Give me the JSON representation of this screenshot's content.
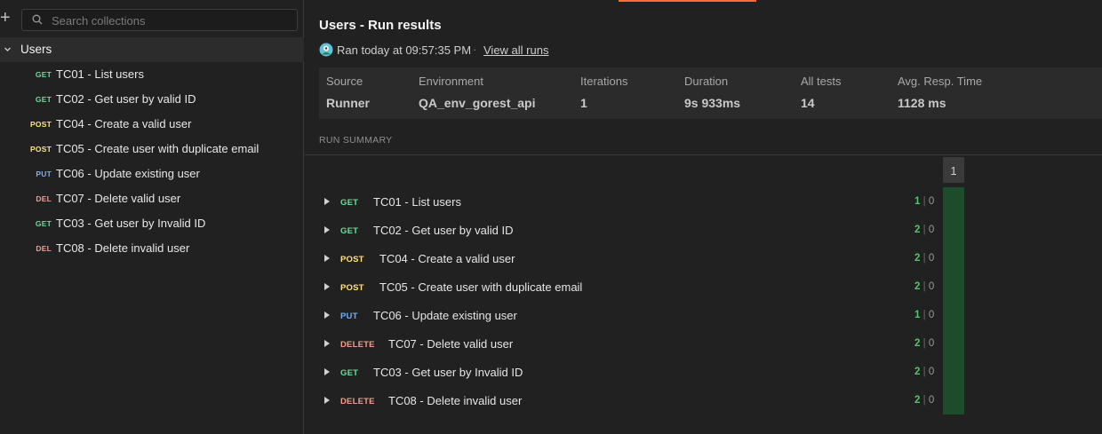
{
  "sidebar": {
    "search_placeholder": "Search collections",
    "collection": {
      "name": "Users"
    },
    "items": [
      {
        "method": "GET",
        "label": "TC01 - List users"
      },
      {
        "method": "GET",
        "label": "TC02 - Get user by valid ID"
      },
      {
        "method": "POST",
        "label": "TC04 - Create a valid user"
      },
      {
        "method": "POST",
        "label": "TC05 - Create user with duplicate email"
      },
      {
        "method": "PUT",
        "label": "TC06 - Update existing user"
      },
      {
        "method": "DEL",
        "label": "TC07 - Delete valid user"
      },
      {
        "method": "GET",
        "label": "TC03 - Get user by Invalid ID"
      },
      {
        "method": "DEL",
        "label": "TC08 - Delete invalid user"
      }
    ]
  },
  "main": {
    "title": "Users - Run results",
    "ran_text": "Ran today at 09:57:35 PM",
    "separator": "·",
    "view_all_runs": "View all runs",
    "stats": [
      {
        "label": "Source",
        "value": "Runner"
      },
      {
        "label": "Environment",
        "value": "QA_env_gorest_api"
      },
      {
        "label": "Iterations",
        "value": "1"
      },
      {
        "label": "Duration",
        "value": "9s 933ms"
      },
      {
        "label": "All tests",
        "value": "14"
      },
      {
        "label": "Avg. Resp. Time",
        "value": "1128 ms"
      }
    ],
    "run_summary_label": "RUN SUMMARY",
    "iteration_header": "1",
    "results": [
      {
        "method": "GET",
        "name": "TC01 - List users",
        "passed": "1",
        "failed": "0"
      },
      {
        "method": "GET",
        "name": "TC02 - Get user by valid ID",
        "passed": "2",
        "failed": "0"
      },
      {
        "method": "POST",
        "name": "TC04 - Create a valid user",
        "passed": "2",
        "failed": "0"
      },
      {
        "method": "POST",
        "name": "TC05 - Create user with duplicate email",
        "passed": "2",
        "failed": "0"
      },
      {
        "method": "PUT",
        "name": "TC06 - Update existing user",
        "passed": "1",
        "failed": "0"
      },
      {
        "method": "DELETE",
        "name": "TC07 - Delete valid user",
        "passed": "2",
        "failed": "0"
      },
      {
        "method": "GET",
        "name": "TC03 - Get user by Invalid ID",
        "passed": "2",
        "failed": "0"
      },
      {
        "method": "DELETE",
        "name": "TC08 - Delete invalid user",
        "passed": "2",
        "failed": "0"
      }
    ],
    "result_separator": "|"
  },
  "colors": {
    "GET": "#6bdd9a",
    "POST": "#ffe47e",
    "PUT": "#74aef6",
    "DELETE": "#f79a8e",
    "pass": "#4fc76a",
    "accent": "#ff6c37"
  }
}
